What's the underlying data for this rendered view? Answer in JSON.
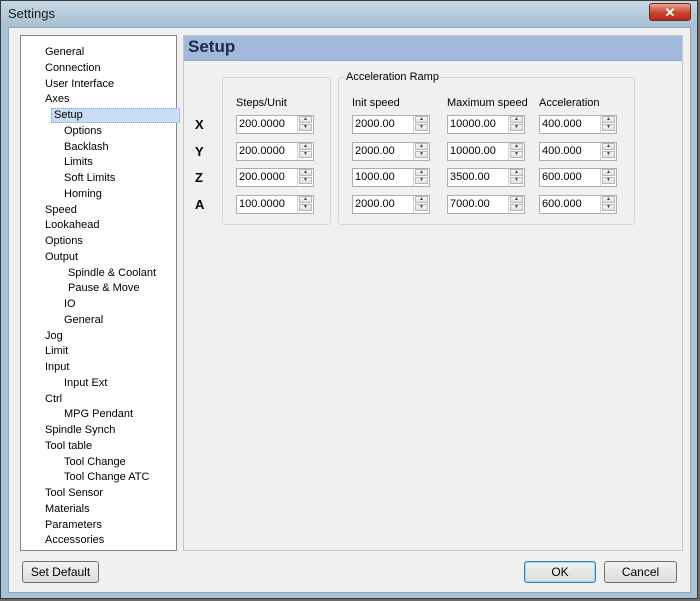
{
  "window": {
    "title": "Settings",
    "close_label": "✕"
  },
  "tree": {
    "items": [
      {
        "label": "General",
        "level": 1,
        "name": "tree-item-general"
      },
      {
        "label": "Connection",
        "level": 1,
        "name": "tree-item-connection"
      },
      {
        "label": "User Interface",
        "level": 1,
        "name": "tree-item-user-interface"
      },
      {
        "label": "Axes",
        "level": 1,
        "name": "tree-item-axes"
      },
      {
        "label": "Setup",
        "level": 2,
        "name": "tree-item-setup",
        "selected": true
      },
      {
        "label": "Options",
        "level": 2,
        "name": "tree-item-axes-options"
      },
      {
        "label": "Backlash",
        "level": 2,
        "name": "tree-item-backlash"
      },
      {
        "label": "Limits",
        "level": 2,
        "name": "tree-item-limits"
      },
      {
        "label": "Soft Limits",
        "level": 2,
        "name": "tree-item-soft-limits"
      },
      {
        "label": "Homing",
        "level": 2,
        "name": "tree-item-homing"
      },
      {
        "label": "Speed",
        "level": 1,
        "name": "tree-item-speed"
      },
      {
        "label": "Lookahead",
        "level": 1,
        "name": "tree-item-lookahead"
      },
      {
        "label": "Options",
        "level": 1,
        "name": "tree-item-options"
      },
      {
        "label": "Output",
        "level": 1,
        "name": "tree-item-output"
      },
      {
        "label": "Spindle & Coolant",
        "level": 3,
        "name": "tree-item-spindle-coolant"
      },
      {
        "label": "Pause & Move",
        "level": 3,
        "name": "tree-item-pause-move"
      },
      {
        "label": "IO",
        "level": 2,
        "name": "tree-item-io"
      },
      {
        "label": "General",
        "level": 2,
        "name": "tree-item-output-general"
      },
      {
        "label": "Jog",
        "level": 1,
        "name": "tree-item-jog"
      },
      {
        "label": "Limit",
        "level": 1,
        "name": "tree-item-limit"
      },
      {
        "label": "Input",
        "level": 1,
        "name": "tree-item-input"
      },
      {
        "label": "Input Ext",
        "level": 2,
        "name": "tree-item-input-ext"
      },
      {
        "label": "Ctrl",
        "level": 1,
        "name": "tree-item-ctrl"
      },
      {
        "label": "MPG Pendant",
        "level": 2,
        "name": "tree-item-mpg-pendant"
      },
      {
        "label": "Spindle Synch",
        "level": 1,
        "name": "tree-item-spindle-synch"
      },
      {
        "label": "Tool table",
        "level": 1,
        "name": "tree-item-tool-table"
      },
      {
        "label": "Tool Change",
        "level": 2,
        "name": "tree-item-tool-change"
      },
      {
        "label": "Tool Change ATC",
        "level": 2,
        "name": "tree-item-tool-change-atc"
      },
      {
        "label": "Tool Sensor",
        "level": 1,
        "name": "tree-item-tool-sensor"
      },
      {
        "label": "Materials",
        "level": 1,
        "name": "tree-item-materials"
      },
      {
        "label": "Parameters",
        "level": 1,
        "name": "tree-item-parameters"
      },
      {
        "label": "Accessories",
        "level": 1,
        "name": "tree-item-accessories"
      }
    ]
  },
  "panel": {
    "title": "Setup",
    "accel_group_label": "Acceleration Ramp",
    "columns": {
      "steps": "Steps/Unit",
      "init": "Init speed",
      "max": "Maximum speed",
      "accel": "Acceleration"
    },
    "axes": [
      {
        "axis": "X",
        "steps": "200.0000",
        "init": "2000.00",
        "max": "10000.00",
        "accel": "400.000"
      },
      {
        "axis": "Y",
        "steps": "200.0000",
        "init": "2000.00",
        "max": "10000.00",
        "accel": "400.000"
      },
      {
        "axis": "Z",
        "steps": "200.0000",
        "init": "1000.00",
        "max": "3500.00",
        "accel": "600.000"
      },
      {
        "axis": "A",
        "steps": "100.0000",
        "init": "2000.00",
        "max": "7000.00",
        "accel": "600.000"
      }
    ]
  },
  "buttons": {
    "set_default": "Set Default",
    "ok": "OK",
    "cancel": "Cancel"
  }
}
